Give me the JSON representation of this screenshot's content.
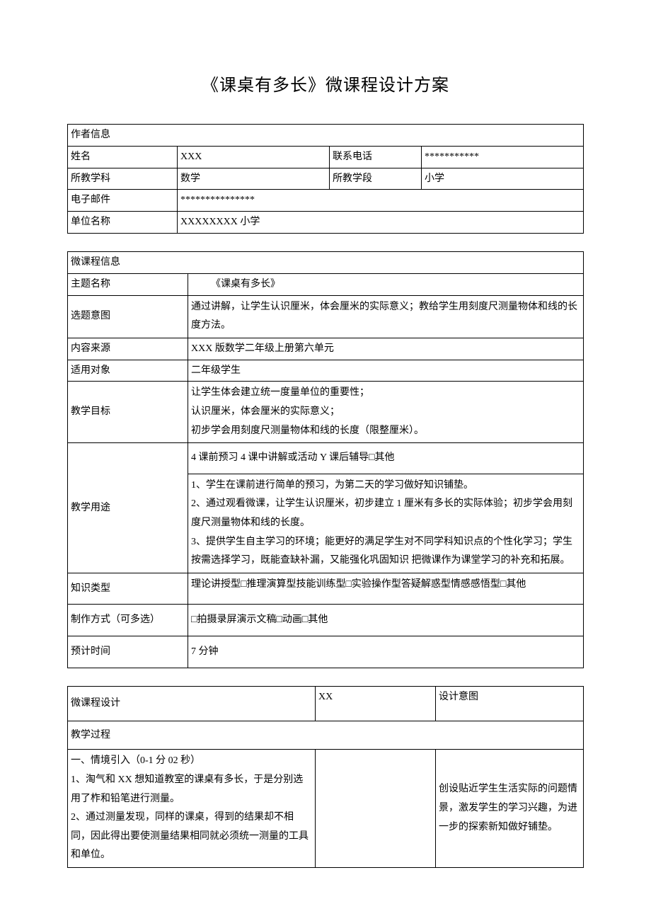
{
  "title": "《课桌有多长》微课程设计方案",
  "t1": {
    "header": "作者信息",
    "r1": {
      "l1": "姓名",
      "v1": "XXX",
      "l2": "联系电话",
      "v2": "***********"
    },
    "r2": {
      "l1": "所教学科",
      "v1": "数学",
      "l2": "所教学段",
      "v2": "小学"
    },
    "r3": {
      "l1": "电子邮件",
      "v1": "***************"
    },
    "r4": {
      "l1": "单位名称",
      "v1": "XXXXXXXX 小学"
    }
  },
  "t2": {
    "header": "微课程信息",
    "rows": {
      "topic": {
        "l": "主题名称",
        "v": "《课桌有多长》"
      },
      "intent": {
        "l": "选题意图",
        "v": "通过讲解，让学生认识厘米，体会厘米的实际意义；教给学生用刻度尺测量物体和线的长度方法。"
      },
      "source": {
        "l": "内容来源",
        "v": "XXX 版数学二年级上册第六单元"
      },
      "audience": {
        "l": "适用对象",
        "v": "二年级学生"
      },
      "goal": {
        "l": "教学目标",
        "v": "让学生体会建立统一度量单位的重要性；\n认识厘米，体会厘米的实际意义；\n初步学会用刻度尺测量物体和线的长度（限整厘米）。"
      },
      "use": {
        "l": "教学用途",
        "top": "4 课前预习 4 课中讲解或活动 Y 课后辅导□其他",
        "body": "1、学生在课前进行简单的预习，为第二天的学习做好知识铺垫。\n2、通过观看微课，让学生认识厘米，初步建立 1 厘米有多长的实际体验；初步学会用刻度尺测量物体和线的长度。\n3、提供学生自主学习的环境；能更好的满足学生对不同学科知识点的个性化学习；学生按需选择学习，既能查缺补漏，又能强化巩固知识 把微课作为课堂学习的补充和拓展。"
      },
      "ktype": {
        "l": "知识类型",
        "v": "理论讲授型□推理演算型技能训练型□实验操作型答疑解惑型情感感悟型□其他"
      },
      "method": {
        "l": "制作方式（可多选）",
        "v": "□拍摄录屏演示文稿□动画□其他"
      },
      "time": {
        "l": "预计时间",
        "v": "7 分钟"
      }
    }
  },
  "t3": {
    "h1": "微课程设计",
    "h2": "XX",
    "h3": "设计意图",
    "process": "教学过程",
    "left": "一、情境引入（0-1 分 02 秒）\n1、淘气和 XX 想知道教室的课桌有多长，于是分别选用了柞和铅笔进行测量。\n2、通过测量发现，同样的课桌，得到的结果却不相同，因此得出要使测量结果相同就必须统一测量的工具和单位。",
    "right": "创设贴近学生生活实际的问题情景，激发学生的学习兴趣，为进一步的探索新知做好铺垫。"
  }
}
